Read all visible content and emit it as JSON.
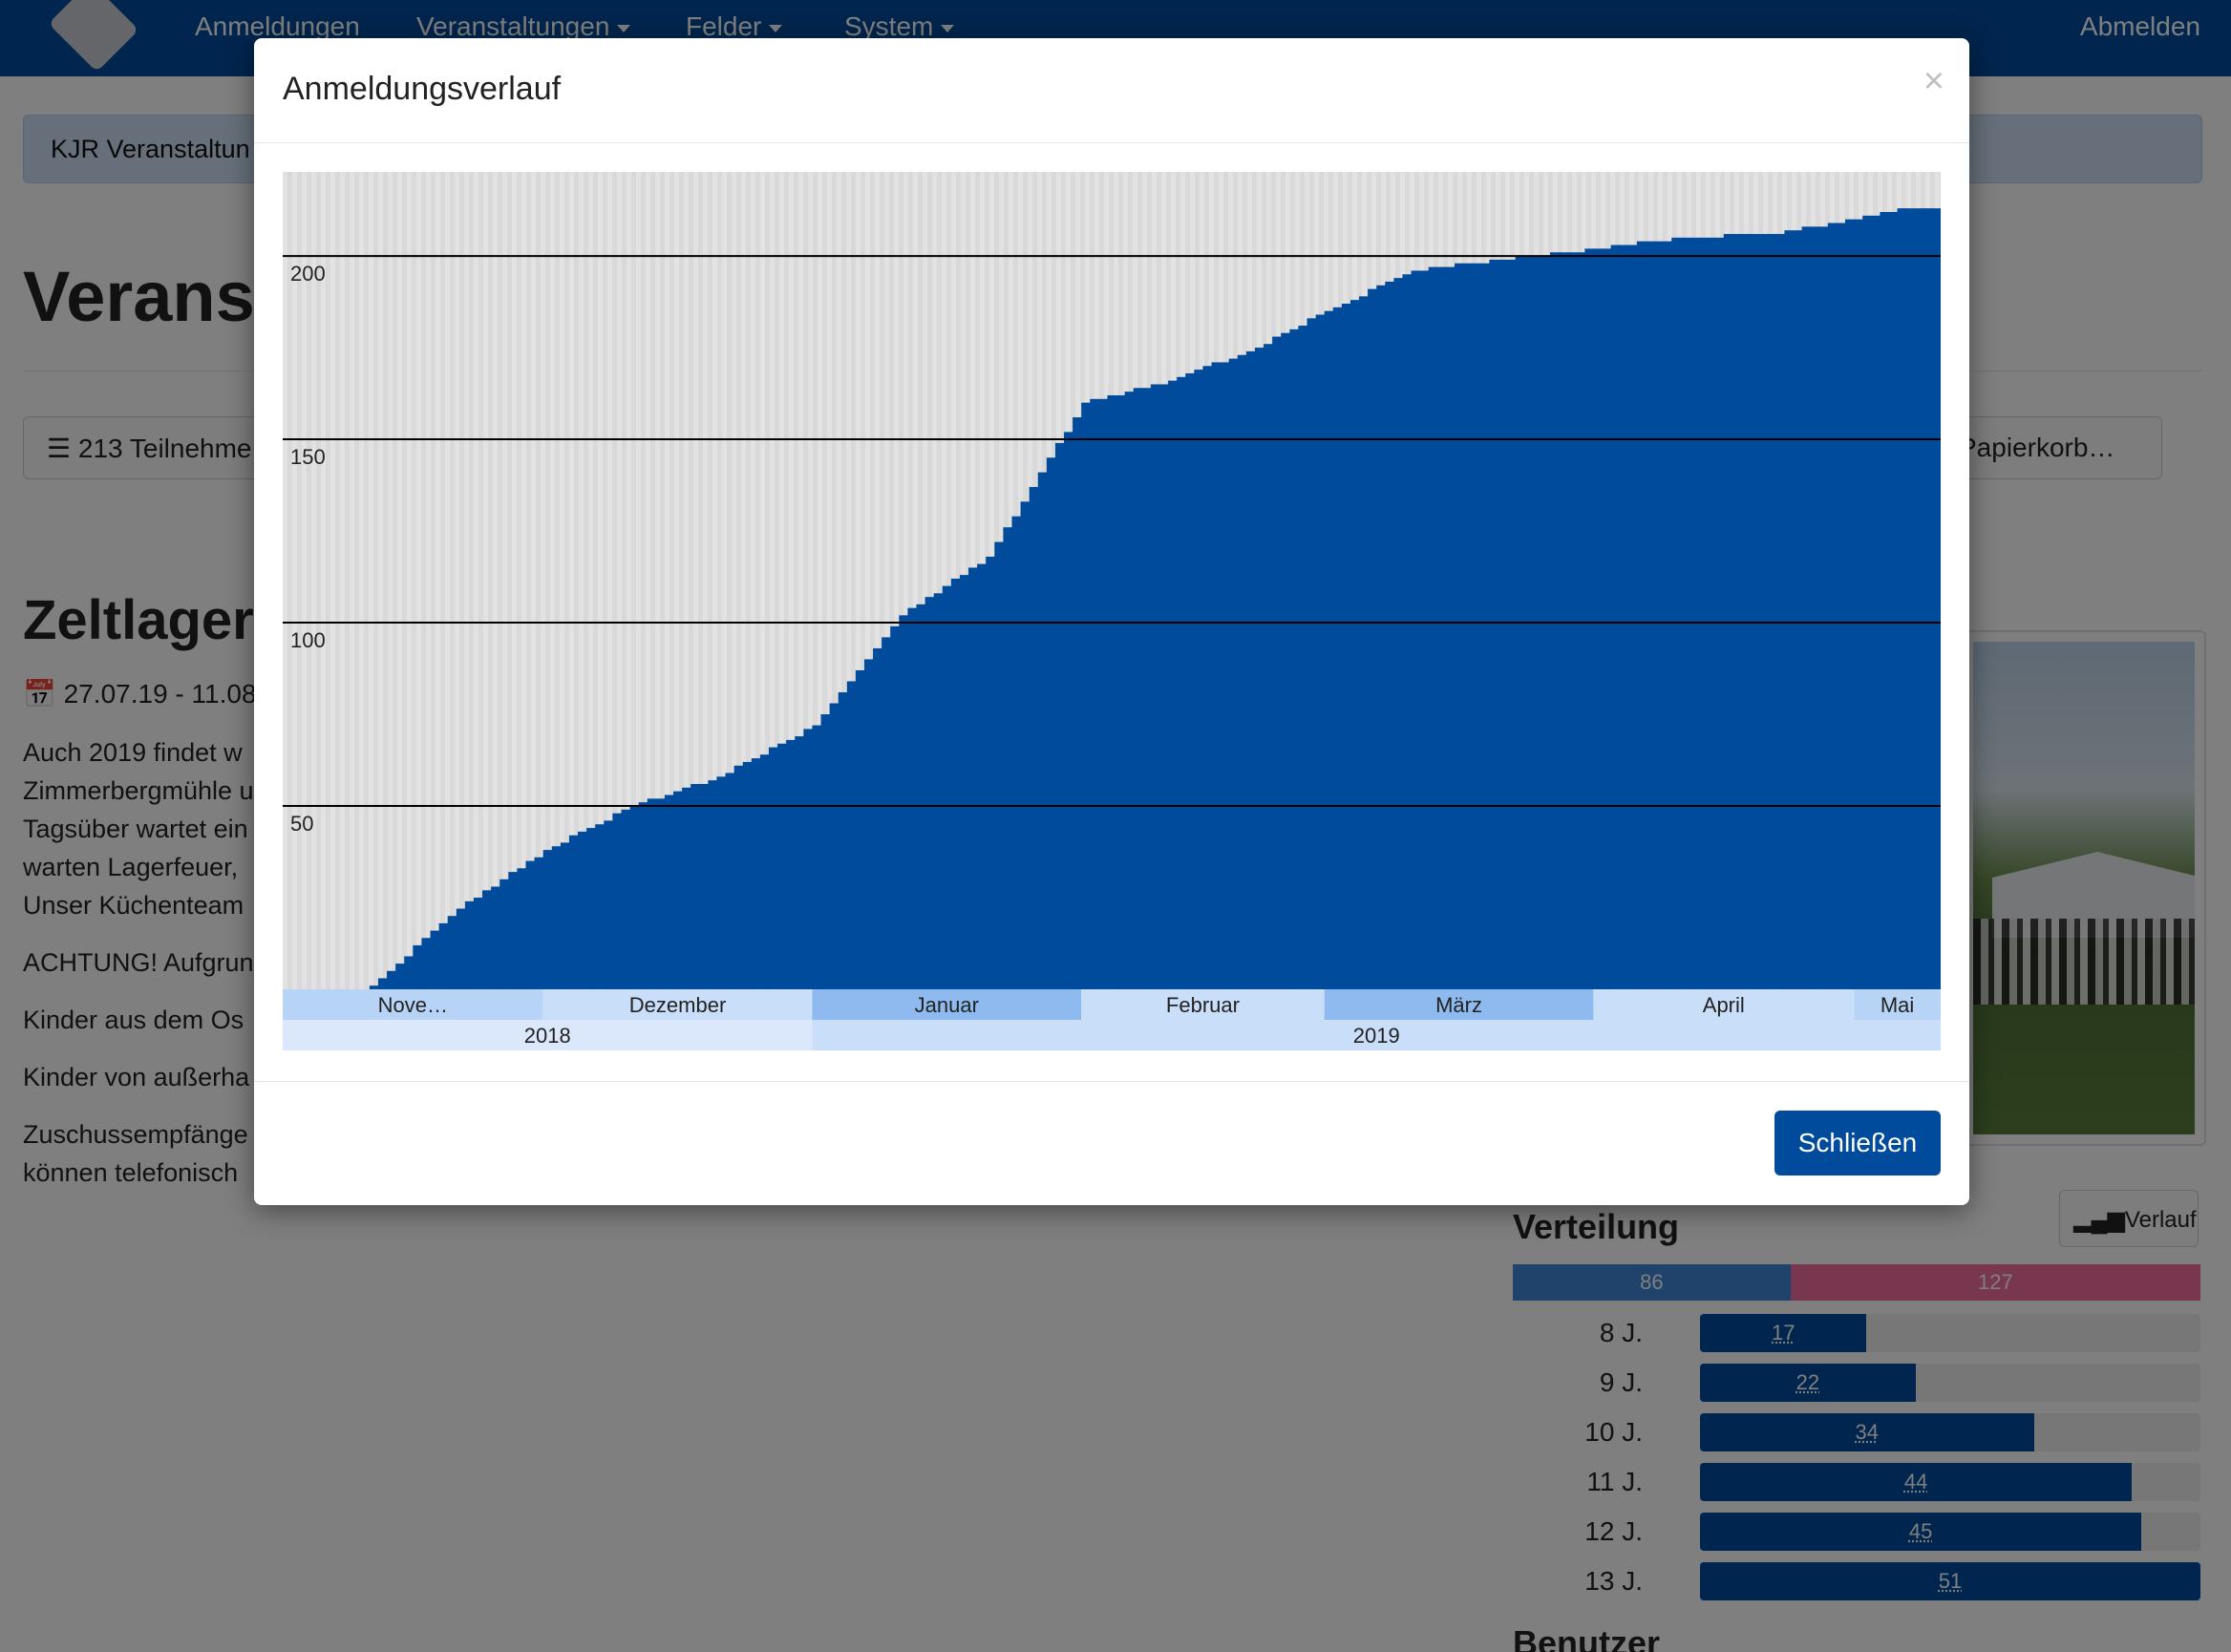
{
  "nav": {
    "items": [
      "Anmeldungen",
      "Veranstaltungen",
      "Felder",
      "System"
    ],
    "logout": "Abmelden"
  },
  "background": {
    "breadcrumb": "KJR Veranstaltun",
    "page_title": "Veranst",
    "participants_button": "213 Teilnehme",
    "trash_button": "Papierkorb…",
    "section_title": "Zeltlager",
    "dates": "27.07.19 - 11.08",
    "paragraphs": [
      "Auch 2019 findet w",
      "Zimmerbergmühle u",
      "Tagsüber wartet ein",
      "warten Lagerfeuer,",
      "Unser Küchenteam",
      "ACHTUNG! Aufgrun",
      "Kinder aus dem Os",
      "Kinder von außerha",
      "Zuschussempfänge",
      "können telefonisch"
    ],
    "verlauf_button": "Verlauf",
    "verteilung_title": "Verteilung",
    "gender": {
      "male": "86",
      "female": "127",
      "male_color": "#3f87d4",
      "female_color": "#f06c9f"
    },
    "ages": [
      {
        "label": "8 J.",
        "value": "17",
        "fraction": 0.333
      },
      {
        "label": "9 J.",
        "value": "22",
        "fraction": 0.431
      },
      {
        "label": "10 J.",
        "value": "34",
        "fraction": 0.667
      },
      {
        "label": "11 J.",
        "value": "44",
        "fraction": 0.863
      },
      {
        "label": "12 J.",
        "value": "45",
        "fraction": 0.882
      },
      {
        "label": "13 J.",
        "value": "51",
        "fraction": 1.0
      }
    ],
    "benutzer_title": "Benutzer"
  },
  "modal": {
    "title": "Anmeldungsverlauf",
    "close_symbol": "×",
    "close_button": "Schließen"
  },
  "colors": {
    "nav": "#004b9c",
    "bar": "#004b9c",
    "accent": "#004b9c"
  },
  "chart_data": {
    "type": "area",
    "title": "",
    "xlabel": "",
    "ylabel": "",
    "ylim": [
      0,
      212
    ],
    "yticks": [
      50,
      100,
      150,
      200
    ],
    "months": [
      "Nove…",
      "Dezember",
      "Januar",
      "Februar",
      "März",
      "April",
      "Mai"
    ],
    "years": [
      "2018",
      "2019"
    ],
    "x": [
      "2018-11-11",
      "2018-11-21",
      "2018-12-01",
      "2018-12-11",
      "2018-12-21",
      "2019-01-01",
      "2019-01-11",
      "2019-01-21",
      "2019-02-01",
      "2019-02-11",
      "2019-02-21",
      "2019-03-01",
      "2019-03-11",
      "2019-03-21",
      "2019-04-01",
      "2019-04-11",
      "2019-04-21",
      "2019-05-01",
      "2019-05-06"
    ],
    "series": [
      {
        "values": [
          1,
          22,
          38,
          50,
          58,
          72,
          102,
          118,
          160,
          166,
          175,
          185,
          196,
          199,
          202,
          205,
          206,
          210,
          213
        ]
      }
    ]
  }
}
